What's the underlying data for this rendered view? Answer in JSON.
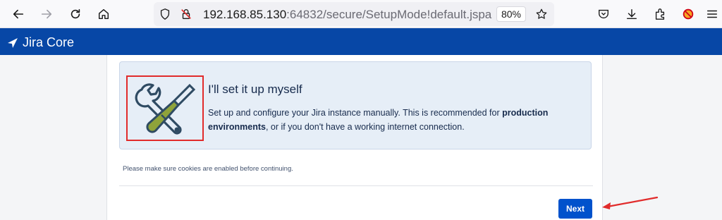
{
  "browser": {
    "url_host": "192.168.85.130",
    "url_rest": ":64832/secure/SetupMode!default.jspa",
    "zoom": "80%"
  },
  "header": {
    "product_name": "Jira Core",
    "brand_color": "#0747a6"
  },
  "setup_option": {
    "title": "I'll set it up myself",
    "desc_prefix": "Set up and configure your Jira instance manually. This is recommended for ",
    "desc_bold": "production environments",
    "desc_suffix": ", or if you don't have a working internet connection.",
    "icon": "tools-icon"
  },
  "cookie_note": "Please make sure cookies are enabled before continuing.",
  "actions": {
    "next_label": "Next"
  },
  "annotation": {
    "highlight_color": "#e12b2b"
  }
}
